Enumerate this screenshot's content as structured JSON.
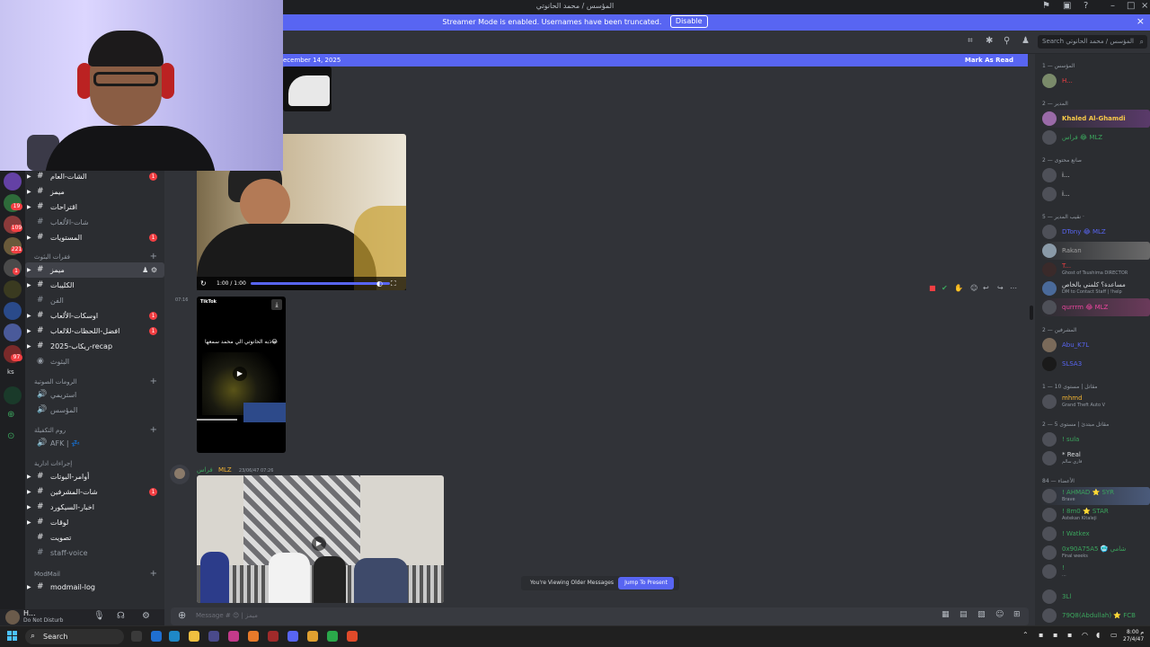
{
  "titlebar": {
    "title": "المؤسس / محمد الحانوتي"
  },
  "banner": {
    "text": "Streamer Mode is enabled. Usernames have been truncated.",
    "button": "Disable"
  },
  "search": {
    "placeholder": "Search المؤسس / محمد الحانوتي"
  },
  "newbar": {
    "date": "ecember 14, 2025",
    "mark_read": "Mark As Read"
  },
  "rail_badges": [
    "19",
    "109",
    "221",
    "1",
    "97"
  ],
  "rail_label": "ks",
  "channels": [
    {
      "name": "الشات-العام",
      "unread": true,
      "badge": "1"
    },
    {
      "name": "ميمز",
      "unread": true
    },
    {
      "name": "اقتراحات",
      "unread": true
    },
    {
      "name": "شات-الألعاب",
      "unread": false
    },
    {
      "name": "المستويات",
      "unread": true,
      "badge": "1"
    },
    {
      "category": "فقرات البثوث"
    },
    {
      "name": "ميمز",
      "active": true
    },
    {
      "name": "الكليبات",
      "unread": true
    },
    {
      "name": "الفن",
      "unread": false
    },
    {
      "name": "اوسكات-الألعاب",
      "unread": true,
      "badge": "1"
    },
    {
      "name": "افضل-اللحظات-للالعاب",
      "unread": true,
      "badge": "1"
    },
    {
      "name": "ريكاب-2025-recap",
      "unread": true
    },
    {
      "name": "البثوث",
      "unread": false,
      "voice": true
    },
    {
      "category": "الرومات الصوتية"
    },
    {
      "name": "استريمي",
      "voice": true
    },
    {
      "name": "المؤسس",
      "voice": true
    },
    {
      "category": "روم التكفيلة"
    },
    {
      "name": "AFK | 💤",
      "voice": true
    },
    {
      "category": "إجراءات ادارية"
    },
    {
      "name": "أوامر-البوتات",
      "unread": true
    },
    {
      "name": "شات-المشرفين",
      "unread": true,
      "badge": "1"
    },
    {
      "name": "اخبار-السيكورد",
      "unread": true
    },
    {
      "name": "لوقات",
      "unread": true
    },
    {
      "name": "تصويت",
      "unread": true
    },
    {
      "name": "staff-voice",
      "voice": true
    },
    {
      "category": "ModMail"
    },
    {
      "name": "modmail-log",
      "unread": true
    }
  ],
  "user": {
    "name": "H...",
    "status": "Do Not Disturb"
  },
  "video": {
    "time": "1:00 / 1:00"
  },
  "tiktok": {
    "brand": "TikTok",
    "caption": "ذبه الحانوتي الي محمد سمعها😂"
  },
  "msg": {
    "time_label": "07:16",
    "author": "فراس",
    "tag": "MLZ",
    "timestamp": "23/06/47 07:26",
    "aria_time": "07:16"
  },
  "older": {
    "text": "You're Viewing Older Messages",
    "button": "Jump To Present"
  },
  "composer": {
    "placeholder": "Message # 😊 | ميمز"
  },
  "members": {
    "groups": [
      {
        "label": "المؤسس — 1"
      },
      {
        "label": "المدير — 2"
      },
      {
        "label": "صانع محتوى — 2"
      },
      {
        "label": "نقيب المدير — 5 ·"
      },
      {
        "label": "المشرفين — 2"
      },
      {
        "label": "مقاتل | مستوى 10 — 1"
      },
      {
        "label": "مقاتل مبتدئ | مستوى 5 — 2"
      },
      {
        "label": "الأعضاء — 84"
      }
    ],
    "list": [
      {
        "name": "H...",
        "color": "#f23f43"
      },
      {
        "name": "Khaled Al-Ghamdi",
        "color": "#f7c948"
      },
      {
        "name": "فراس 😂 MLZ",
        "color": "#3ba55d"
      },
      {
        "name": "i...",
        "color": "#dbdee1"
      },
      {
        "name": "i...",
        "color": "#dbdee1"
      },
      {
        "name": "DTony 😂 MLZ",
        "color": "#5865f2"
      },
      {
        "name": "Rakan",
        "color": "#a0a0a0"
      },
      {
        "name": "T...",
        "color": "#f23f43",
        "sub": "Ghost of Tsushima DIRECTOR"
      },
      {
        "name": "مساعدة؟ كلمني بالخاص",
        "color": "#dbdee1",
        "sub": "DM to Contact Staff | !help"
      },
      {
        "name": "qurrrm 😂 MLZ",
        "color": "#eb459e"
      },
      {
        "name": "Abu_K7L",
        "color": "#5865f2"
      },
      {
        "name": "SLSA3",
        "color": "#5865f2"
      },
      {
        "name": "mhmd",
        "color": "#f0b232",
        "sub": "Grand Theft Auto V"
      },
      {
        "name": "! sula",
        "color": "#3ba55d"
      },
      {
        "name": "* Real",
        "color": "#dbdee1",
        "sub": "فاري سالم"
      },
      {
        "name": "! AHMAD ⭐ SYR",
        "color": "#3ba55d",
        "sub": "Brave"
      },
      {
        "name": "! 8m0 ⭐ STAR",
        "color": "#3ba55d",
        "sub": "Astekan Kitaleji"
      },
      {
        "name": "! Watkex",
        "color": "#3ba55d"
      },
      {
        "name": "0x90A75A5 🥶 شامي",
        "color": "#3ba55d",
        "sub": "Final weeks"
      },
      {
        "name": "!",
        "color": "#3ba55d",
        "sub": "..."
      },
      {
        "name": "3Ll",
        "color": "#3ba55d"
      },
      {
        "name": "79Q8(Abdullah) ⭐ FCB",
        "color": "#3ba55d"
      }
    ]
  },
  "taskbar": {
    "search": "Search",
    "time": "8:00 م",
    "date": "27/4/47"
  },
  "colors": {
    "accent": "#5865f2",
    "danger": "#f23f43",
    "bg": "#313338"
  },
  "icons": [
    "search-icon",
    "pin-icon",
    "members-icon",
    "threads-icon",
    "gear-icon",
    "mic-icon",
    "headphones-icon",
    "plus-icon",
    "gift-icon",
    "emoji-icon",
    "play-icon",
    "download-icon"
  ]
}
